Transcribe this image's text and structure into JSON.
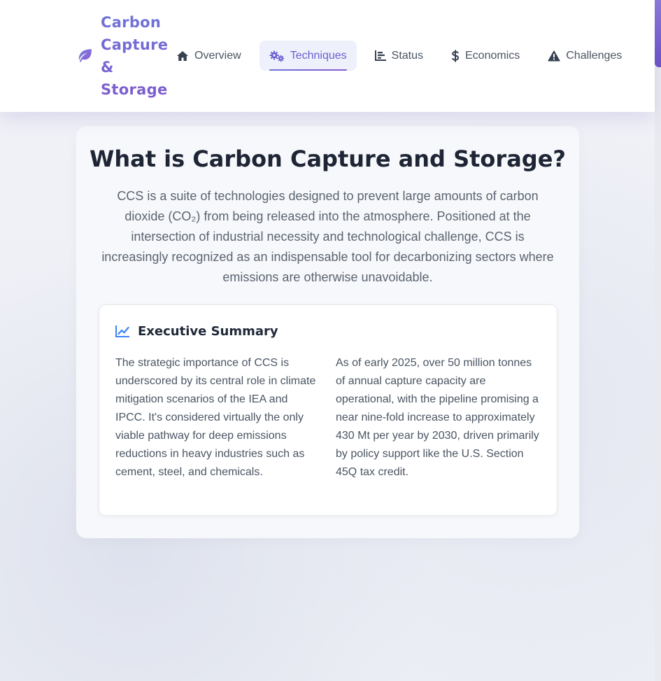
{
  "brand": {
    "title": "Carbon Capture & Storage",
    "icon": "leaf-icon"
  },
  "nav": {
    "items": [
      {
        "label": "Overview",
        "icon": "home-icon"
      },
      {
        "label": "Techniques",
        "icon": "cogs-icon",
        "active": true
      },
      {
        "label": "Status",
        "icon": "bar-chart-icon"
      },
      {
        "label": "Economics",
        "icon": "dollar-icon"
      },
      {
        "label": "Challenges",
        "icon": "warning-icon"
      }
    ]
  },
  "hero": {
    "title": "What is Carbon Capture and Storage?",
    "description": "CCS is a suite of technologies designed to prevent large amounts of carbon dioxide (CO₂) from being released into the atmosphere. Positioned at the intersection of industrial necessity and technological challenge, CCS is increasingly recognized as an indispensable tool for decarbonizing sectors where emissions are otherwise unavoidable."
  },
  "summary": {
    "title": "Executive Summary",
    "icon": "line-chart-icon",
    "left_text": "The strategic importance of CCS is underscored by its central role in climate mitigation scenarios of the IEA and IPCC. It's considered virtually the only viable pathway for deep emissions reductions in heavy industries such as cement, steel, and chemicals.",
    "right_text": "As of early 2025, over 50 million tonnes of annual capture capacity are operational, with the pipeline promising a near nine-fold increase to approximately 430 Mt per year by 2030, driven primarily by policy support like the U.S. Section 45Q tax credit."
  },
  "colors": {
    "accent": "#6a5fd0",
    "accent_gradient_start": "#6d74d8",
    "accent_gradient_end": "#8a5bd0",
    "icon_blue": "#3b82f6",
    "text_dark": "#1e2535",
    "text_muted": "#5b6470"
  }
}
